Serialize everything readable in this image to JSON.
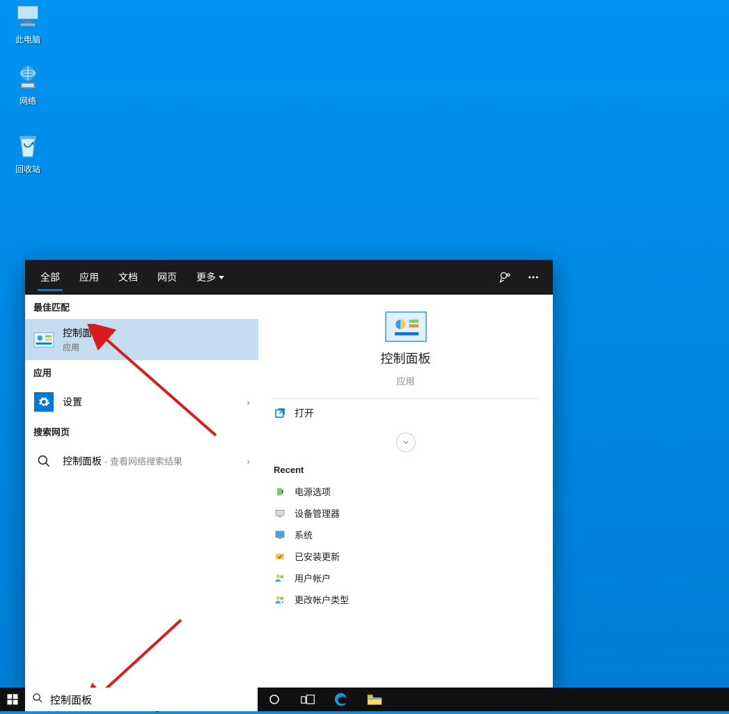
{
  "desktop": {
    "icons": [
      {
        "name": "this-pc",
        "label": "此电脑"
      },
      {
        "name": "network",
        "label": "网络"
      },
      {
        "name": "recycle-bin",
        "label": "回收站"
      }
    ]
  },
  "search_panel": {
    "tabs": {
      "all": "全部",
      "apps": "应用",
      "documents": "文档",
      "web": "网页",
      "more": "更多"
    },
    "sections": {
      "best_match": "最佳匹配",
      "apps": "应用",
      "search_web": "搜索网页",
      "recent": "Recent"
    },
    "best_match": {
      "title": "控制面板",
      "subtitle": "应用"
    },
    "apps_list": [
      {
        "label": "设置"
      }
    ],
    "web": {
      "query": "控制面板",
      "suffix": "- 查看网络搜索结果"
    },
    "detail": {
      "title": "控制面板",
      "subtitle": "应用",
      "open_label": "打开"
    },
    "recent": [
      {
        "label": "电源选项"
      },
      {
        "label": "设备管理器"
      },
      {
        "label": "系统"
      },
      {
        "label": "已安装更新"
      },
      {
        "label": "用户帐户"
      },
      {
        "label": "更改帐户类型"
      }
    ]
  },
  "taskbar": {
    "search_value": "控制面板"
  }
}
